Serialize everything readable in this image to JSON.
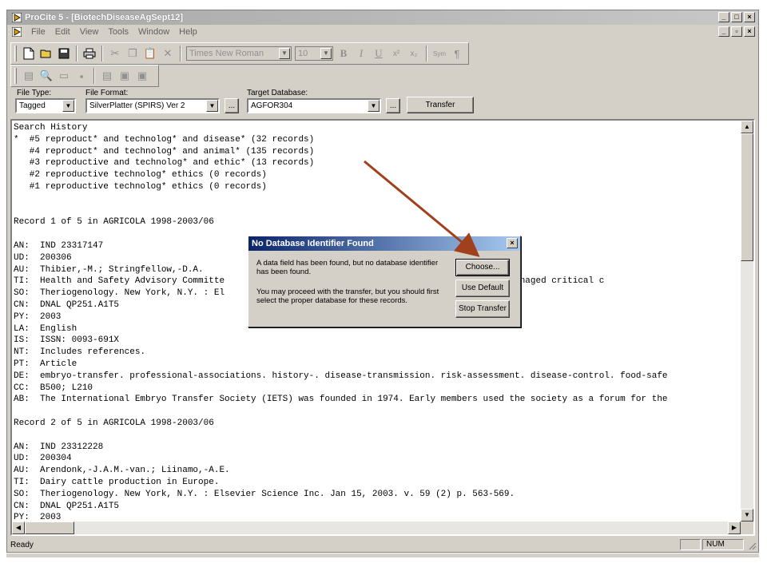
{
  "window": {
    "title": "ProCite 5 - [BiotechDiseaseAgSept12]",
    "caption_buttons": [
      "_",
      "□",
      "×"
    ]
  },
  "menu": {
    "items": [
      "File",
      "Edit",
      "View",
      "Tools",
      "Window",
      "Help"
    ],
    "mdi_buttons": [
      "_",
      "▫",
      "×"
    ]
  },
  "toolbar": {
    "font_name": "Times New Roman",
    "font_size": "10",
    "bold": "B",
    "italic": "I",
    "underline": "U",
    "superscript": "x²",
    "subscript": "x₂",
    "symbol": "Sym",
    "paragraph": "¶"
  },
  "import": {
    "file_type_label": "File Type:",
    "file_type_value": "Tagged",
    "file_format_label": "File Format:",
    "file_format_value": "SilverPlatter (SPIRS) Ver 2",
    "target_db_label": "Target Database:",
    "target_db_value": "AGFOR304",
    "browse_label": "...",
    "transfer_label": "Transfer"
  },
  "content": {
    "lines": [
      "Search History",
      "*  #5 reproduct* and technolog* and disease* (32 records)",
      "   #4 reproduct* and technolog* and animal* (135 records)",
      "   #3 reproductive and technolog* and ethic* (13 records)",
      "   #2 reproductive technolog* ethics (0 records)",
      "   #1 reproductive technolog* ethics (0 records)",
      "",
      "",
      "Record 1 of 5 in AGRICOLA 1998-2003/06",
      "",
      "AN:  IND 23317147",
      "UD:  200306",
      "AU:  Thibier,-M.; Stringfellow,-D.A.",
      "TI:  Health and Safety Advisory Committe                                   Society (IETS) has managed critical c",
      "SO:  Theriogenology. New York, N.Y. : El                                   067-1078.",
      "CN:  DNAL QP251.A1T5",
      "PY:  2003",
      "LA:  English",
      "IS:  ISSN: 0093-691X",
      "NT:  Includes references.",
      "PT:  Article",
      "DE:  embryo-transfer. professional-associations. history-. disease-transmission. risk-assessment. disease-control. food-safe",
      "CC:  B500; L210",
      "AB:  The International Embryo Transfer Society (IETS) was founded in 1974. Early members used the society as a forum for the",
      "",
      "Record 2 of 5 in AGRICOLA 1998-2003/06",
      "",
      "AN:  IND 23312228",
      "UD:  200304",
      "AU:  Arendonk,-J.A.M.-van.; Liinamo,-A.E.",
      "TI:  Dairy cattle production in Europe.",
      "SO:  Theriogenology. New York, N.Y. : Elsevier Science Inc. Jan 15, 2003. v. 59 (2) p. 563-569.",
      "CN:  DNAL QP251.A1T5",
      "PY:  2003"
    ]
  },
  "dialog": {
    "title": "No Database Identifier Found",
    "close": "×",
    "message1": "A data field has been found, but no database identifier has been found.",
    "message2": "You may proceed with the transfer, but you should first select the proper database for these records.",
    "choose_label": "Choose...",
    "use_default_label": "Use Default",
    "stop_transfer_label": "Stop Transfer"
  },
  "status": {
    "text": "Ready",
    "num": "NUM"
  },
  "colors": {
    "dialog_title_start": "#0a246a",
    "dialog_title_end": "#a6caf0",
    "arrow": "#a0401c"
  }
}
